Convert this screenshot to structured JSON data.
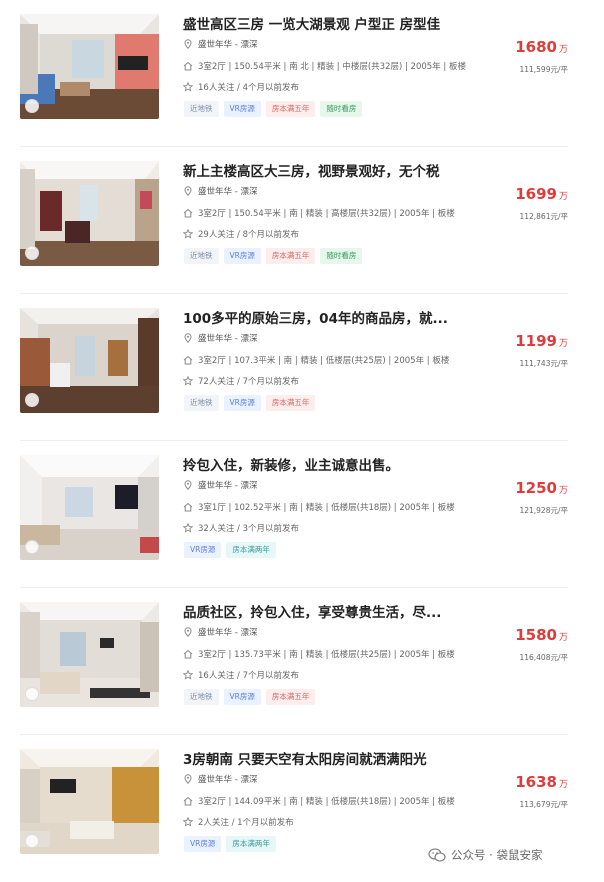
{
  "listings": [
    {
      "title": "盛世高区三房 一览大湖景观 户型正 房型佳",
      "location": "盛世年华 - 漂深",
      "info": "3室2厅 | 150.54平米 | 南 北 | 精装 | 中楼层(共32层) | 2005年 | 板楼",
      "follow": "16人关注 / 4个月以前发布",
      "price": "1680",
      "price_unit": "万",
      "unit_price": "111,599元/平",
      "tags": [
        {
          "label": "近地铁",
          "style": "gray"
        },
        {
          "label": "VR房源",
          "style": "blue"
        },
        {
          "label": "房本满五年",
          "style": "red"
        },
        {
          "label": "随时看房",
          "style": "green"
        }
      ]
    },
    {
      "title": "新上主楼高区大三房，视野景观好，无个税",
      "location": "盛世年华 - 漂深",
      "info": "3室2厅 | 150.54平米 | 南 | 精装 | 高楼层(共32层) | 2005年 | 板楼",
      "follow": "29人关注 / 8个月以前发布",
      "price": "1699",
      "price_unit": "万",
      "unit_price": "112,861元/平",
      "tags": [
        {
          "label": "近地铁",
          "style": "gray"
        },
        {
          "label": "VR房源",
          "style": "blue"
        },
        {
          "label": "房本满五年",
          "style": "red"
        },
        {
          "label": "随时看房",
          "style": "green"
        }
      ]
    },
    {
      "title": "100多平的原始三房，04年的商品房，就...",
      "location": "盛世年华 - 漂深",
      "info": "3室2厅 | 107.3平米 | 南 | 精装 | 低楼层(共25层) | 2005年 | 板楼",
      "follow": "72人关注 / 7个月以前发布",
      "price": "1199",
      "price_unit": "万",
      "unit_price": "111,743元/平",
      "tags": [
        {
          "label": "近地铁",
          "style": "gray"
        },
        {
          "label": "VR房源",
          "style": "blue"
        },
        {
          "label": "房本满五年",
          "style": "red"
        }
      ]
    },
    {
      "title": "拎包入住，新装修，业主诚意出售。",
      "location": "盛世年华 - 漂深",
      "info": "3室1厅 | 102.52平米 | 南 | 精装 | 低楼层(共18层) | 2005年 | 板楼",
      "follow": "32人关注 / 3个月以前发布",
      "price": "1250",
      "price_unit": "万",
      "unit_price": "121,928元/平",
      "tags": [
        {
          "label": "VR房源",
          "style": "blue"
        },
        {
          "label": "房本满两年",
          "style": "cyan"
        }
      ]
    },
    {
      "title": "品质社区，拎包入住，享受尊贵生活，尽...",
      "location": "盛世年华 - 漂深",
      "info": "3室2厅 | 135.73平米 | 南 | 精装 | 低楼层(共25层) | 2005年 | 板楼",
      "follow": "16人关注 / 7个月以前发布",
      "price": "1580",
      "price_unit": "万",
      "unit_price": "116,408元/平",
      "tags": [
        {
          "label": "近地铁",
          "style": "gray"
        },
        {
          "label": "VR房源",
          "style": "blue"
        },
        {
          "label": "房本满五年",
          "style": "red"
        }
      ]
    },
    {
      "title": "3房朝南 只要天空有太阳房间就洒满阳光",
      "location": "盛世年华 - 漂深",
      "info": "3室2厅 | 144.09平米 | 南 | 精装 | 低楼层(共18层) | 2005年 | 板楼",
      "follow": "2人关注 / 1个月以前发布",
      "price": "1638",
      "price_unit": "万",
      "unit_price": "113,679元/平",
      "tags": [
        {
          "label": "VR房源",
          "style": "blue"
        },
        {
          "label": "房本满两年",
          "style": "cyan"
        }
      ]
    }
  ],
  "watermark": {
    "text": "公众号 · 袋鼠安家",
    "icon": "wechat-icon"
  },
  "colors": {
    "price": "#e03b3b",
    "tag_gray": "#7a8aa3",
    "tag_blue": "#5c7fe0",
    "tag_red": "#e06060",
    "tag_green": "#3a9a5c",
    "tag_cyan": "#3a9aa0"
  },
  "icons": {
    "location": "location-pin-icon",
    "info": "house-icon",
    "follow": "star-icon",
    "vr": "vr-view-icon"
  }
}
